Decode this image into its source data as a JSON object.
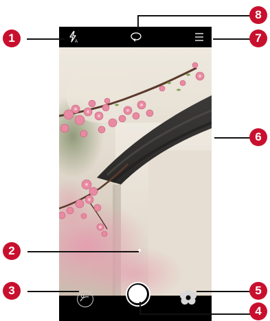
{
  "callouts": {
    "n1": "1",
    "n2": "2",
    "n3": "3",
    "n4": "4",
    "n5": "5",
    "n6": "6",
    "n7": "7",
    "n8": "8"
  },
  "icons": {
    "flash": "flash-auto-icon",
    "switch_camera": "switch-camera-icon",
    "menu": "menu-icon",
    "gallery": "gallery-thumbnail-icon",
    "shutter": "shutter-button",
    "filter": "filter-icon",
    "mode_indicator": "mode-page-indicator"
  },
  "colors": {
    "callout_badge": "#c8102e",
    "bar_background": "#000000"
  }
}
